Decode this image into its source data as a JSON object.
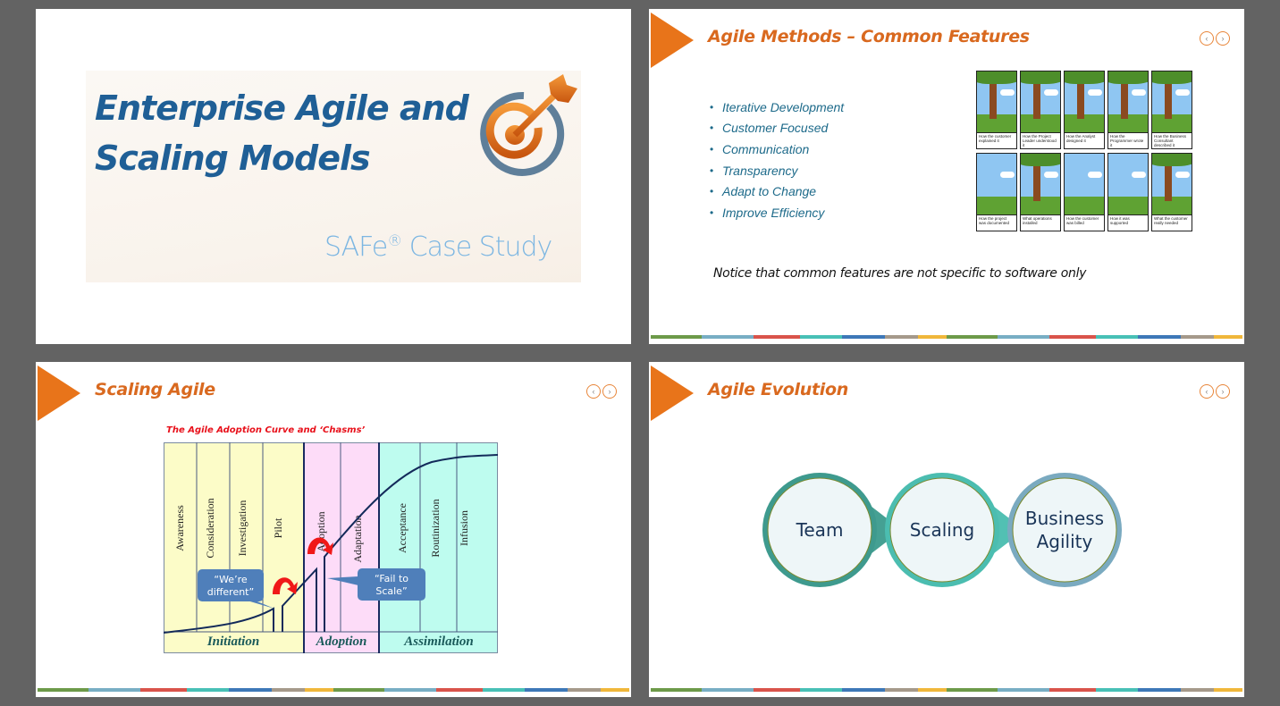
{
  "colors": {
    "accent_orange": "#e8741a",
    "title_orange": "#d9691f",
    "title_blue": "#1f5f96",
    "subtitle_blue": "#7cb6e2",
    "bullet_teal": "#1d6a8a",
    "chart_red": "#e8101a",
    "footer_strip": [
      "#6d9a49",
      "#78aec4",
      "#d9534a",
      "#48c0b6",
      "#3d78b8",
      "#a5998a",
      "#f0b73a"
    ]
  },
  "nav": {
    "prev": "‹",
    "next": "›"
  },
  "slides": [
    {
      "title": "Enterprise Agile and Scaling Models",
      "title_line1": "Enterprise Agile and",
      "title_line2": "Scaling Models",
      "subtitle": "SAFe",
      "subtitle_reg": "®",
      "subtitle_rest": " Case Study",
      "icon": "target-arrow-icon"
    },
    {
      "title": "Agile Methods – Common Features",
      "bullets": [
        "Iterative Development",
        "Customer Focused",
        "Communication",
        "Transparency",
        "Adapt to Change",
        "Improve Efficiency"
      ],
      "notice": "Notice that common features are not specific to software only",
      "comic_captions": [
        "How the customer explained it",
        "How the Project Leader understood it",
        "How the Analyst designed it",
        "How the Programmer wrote it",
        "How the Business Consultant described it",
        "How the project was documented",
        "What operations installed",
        "How the customer was billed",
        "How it was supported",
        "What the customer really needed"
      ]
    },
    {
      "title": "Scaling Agile",
      "diagram": {
        "title": "The Agile Adoption Curve and ‘Chasms’",
        "stages": [
          "Awareness",
          "Consideration",
          "Investigation",
          "Pilot",
          "Adoption",
          "Adaptation",
          "Acceptance",
          "Routinization",
          "Infusion"
        ],
        "phases": [
          "Initiation",
          "Adoption",
          "Assimilation"
        ],
        "callout1": [
          "“We’re",
          "different”"
        ],
        "callout2": [
          "“Fail to",
          "Scale”"
        ]
      }
    },
    {
      "title": "Agile Evolution",
      "steps": [
        {
          "label": [
            "Team"
          ]
        },
        {
          "label": [
            "Scaling"
          ]
        },
        {
          "label": [
            "Business",
            "Agility"
          ]
        }
      ]
    }
  ]
}
